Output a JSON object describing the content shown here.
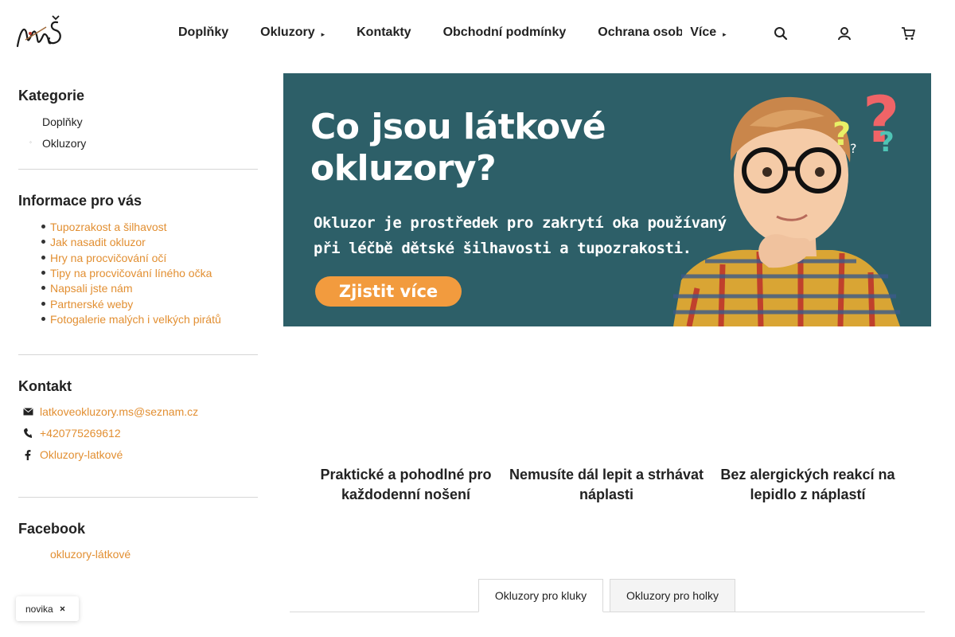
{
  "header": {
    "logo_text": "MŠ",
    "nav": [
      {
        "label": "Doplňky"
      },
      {
        "label": "Okluzory",
        "caret": "▸"
      },
      {
        "label": "Kontakty"
      },
      {
        "label": "Obchodní podmínky"
      },
      {
        "label": "Ochrana osob"
      },
      {
        "label": "Více",
        "caret": "▸"
      }
    ],
    "icons": [
      "search-icon",
      "user-icon",
      "cart-icon"
    ]
  },
  "sidebar": {
    "categories_title": "Kategorie",
    "categories": [
      "Doplňky",
      "Okluzory"
    ],
    "info_title": "Informace pro vás",
    "info_links": [
      "Tupozrakost a šilhavost",
      "Jak nasadit okluzor",
      "Hry na procvičování očí",
      "Tipy na procvičování líného očka",
      "Napsali jste nám",
      "Partnerské weby",
      "Fotogalerie malých i velkých pirátů"
    ],
    "contact_title": "Kontakt",
    "contacts": [
      {
        "icon": "envelope-icon",
        "label": "latkoveokluzory.ms@seznam.cz"
      },
      {
        "icon": "phone-icon",
        "label": "+420775269612"
      },
      {
        "icon": "facebook-icon",
        "label": "Okluzory-latkové"
      }
    ],
    "facebook_title": "Facebook",
    "facebook_link": "okluzory-látkové"
  },
  "banner": {
    "title_line1": "Co jsou látkové",
    "title_line2": "okluzory?",
    "text_line1": "Okluzor je prostředek pro zakrytí oka používaný",
    "text_line2": "při léčbě dětské šilhavosti a tupozrakosti.",
    "button": "Zjistit více",
    "colors": {
      "background": "#2d5f68",
      "button": "#f29b3e",
      "question_marks": [
        "#e8f067",
        "#f06467",
        "#4fc4b5"
      ]
    }
  },
  "features": [
    {
      "line1": "Praktické a pohodlné pro",
      "line2": "každodenní nošení"
    },
    {
      "line1": "Nemusíte dál lepit a strhávat",
      "line2": "náplasti"
    },
    {
      "line1": "Bez alergických reakcí na",
      "line2": "lepidlo z náplastí"
    }
  ],
  "tabs": [
    "Okluzory pro kluky",
    "Okluzory pro holky"
  ],
  "badge": {
    "label": "novika",
    "icon": "close-icon"
  },
  "colors": {
    "link": "#e28f32",
    "separator": "#d6d6d6"
  }
}
